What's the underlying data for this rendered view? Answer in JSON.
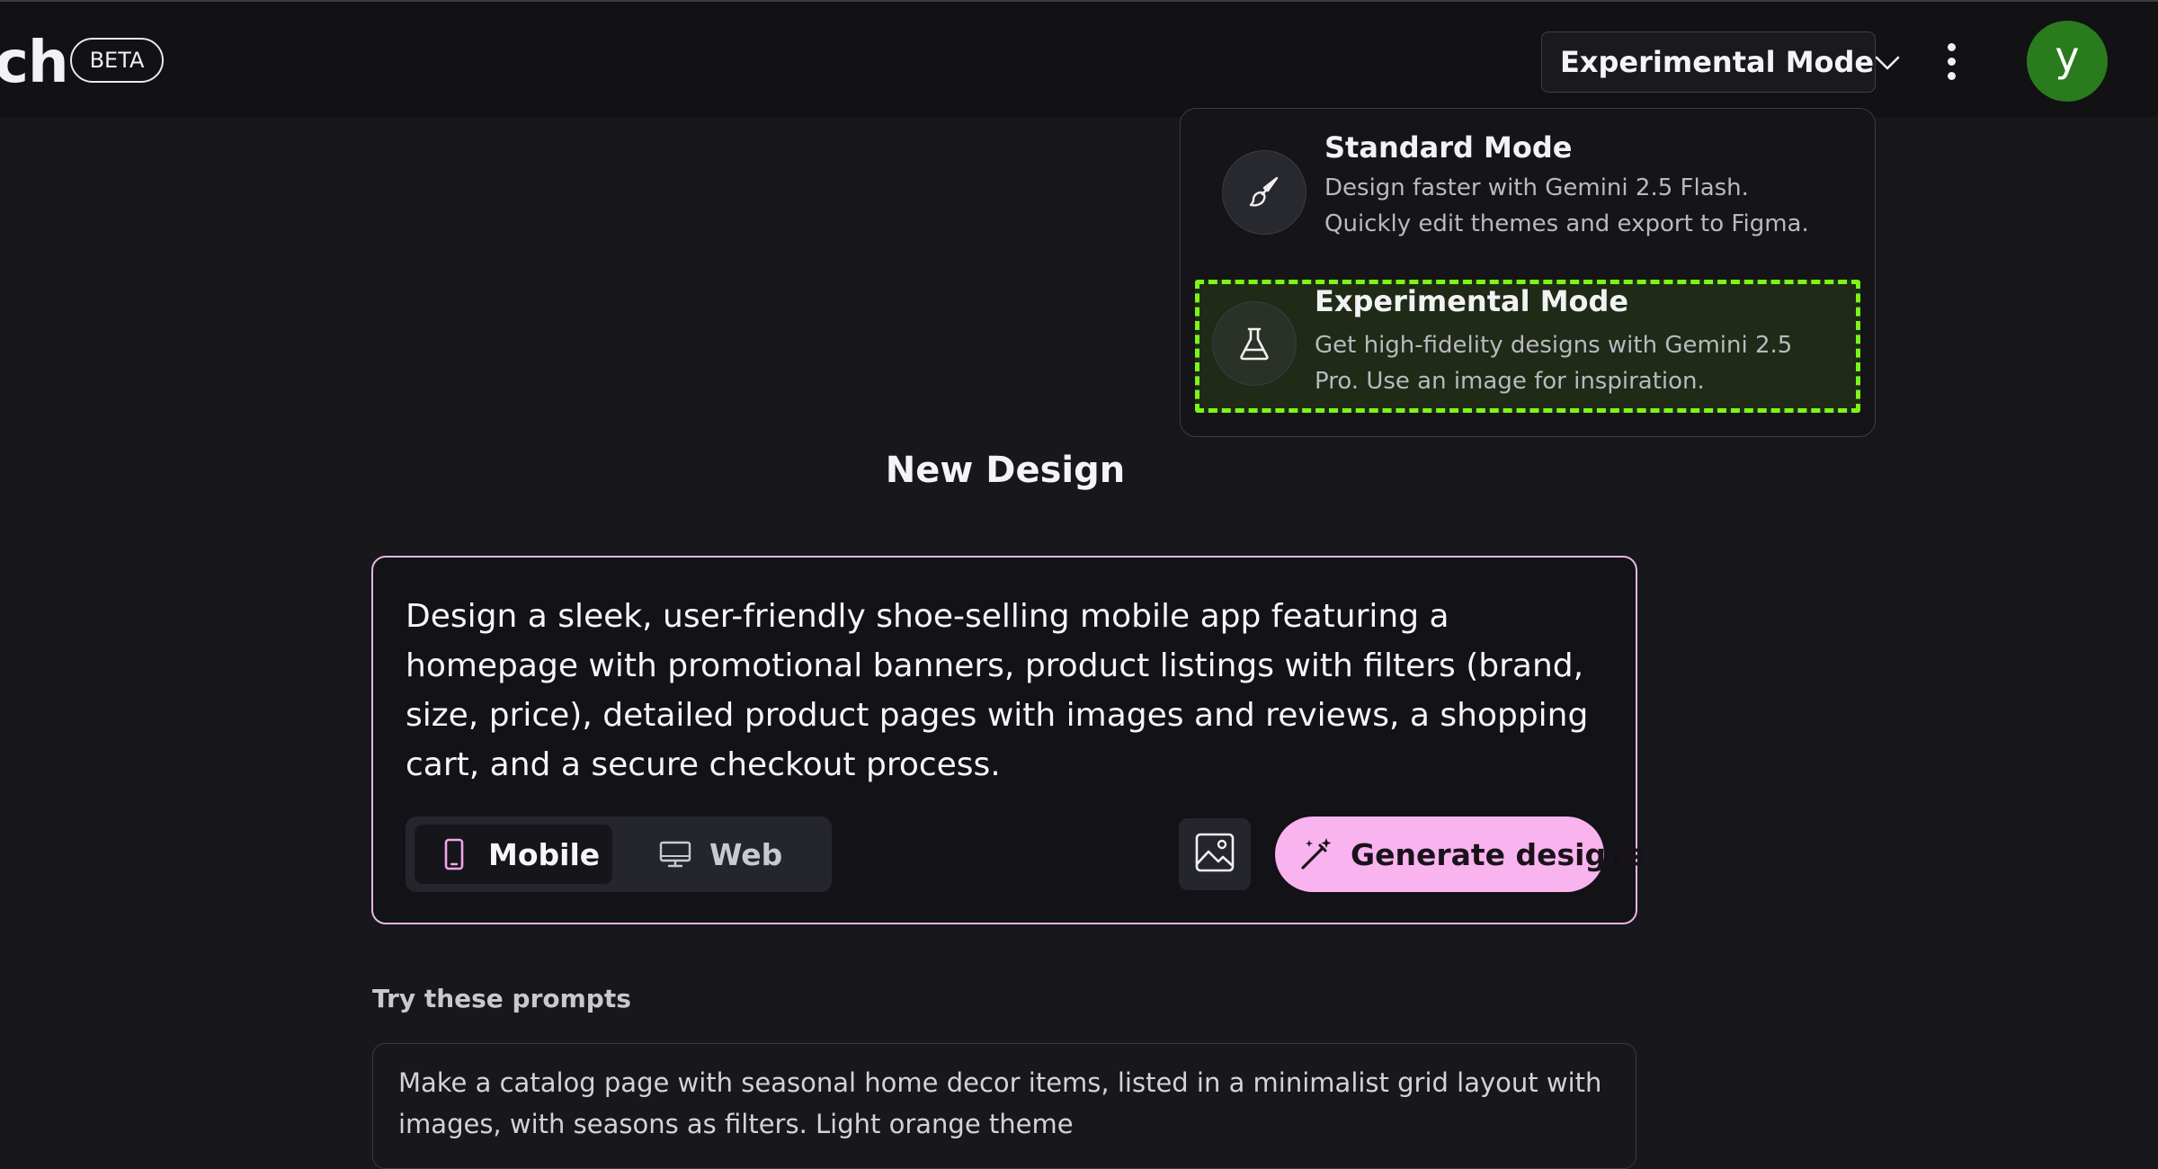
{
  "header": {
    "brand_fragment": "ch",
    "beta_badge": "BETA",
    "mode_selector": {
      "selected": "Experimental Mode",
      "icon": "chevron-down-icon"
    },
    "more_menu_icon": "more-vertical-icon",
    "avatar_initial": "y",
    "avatar_color": "#2a7a1e"
  },
  "mode_dropdown": {
    "options": [
      {
        "title": "Standard Mode",
        "description": "Design faster with Gemini 2.5 Flash. Quickly edit themes and export to Figma.",
        "icon": "paintbrush-icon",
        "selected": false
      },
      {
        "title": "Experimental Mode",
        "description": "Get high-fidelity designs with Gemini 2.5 Pro. Use an image for inspiration.",
        "icon": "flask-icon",
        "selected": true
      }
    ],
    "highlight_color": "#7cf617"
  },
  "main": {
    "title": "New Design",
    "prompt_text": "Design a sleek, user-friendly shoe-selling mobile app featuring a homepage with promotional banners, product listings with filters (brand, size, price), detailed product pages with images and reviews, a shopping cart, and a secure checkout process.",
    "device_toggle": {
      "mobile_label": "Mobile",
      "web_label": "Web",
      "selected": "Mobile"
    },
    "image_button_icon": "image-icon",
    "generate_label": "Generate designs",
    "generate_color": "#f9b3ee",
    "try_prompts_label": "Try these prompts",
    "suggestions": [
      "Make a catalog page with seasonal home decor items, listed in a minimalist grid layout with images, with seasons as filters. Light orange theme"
    ]
  }
}
